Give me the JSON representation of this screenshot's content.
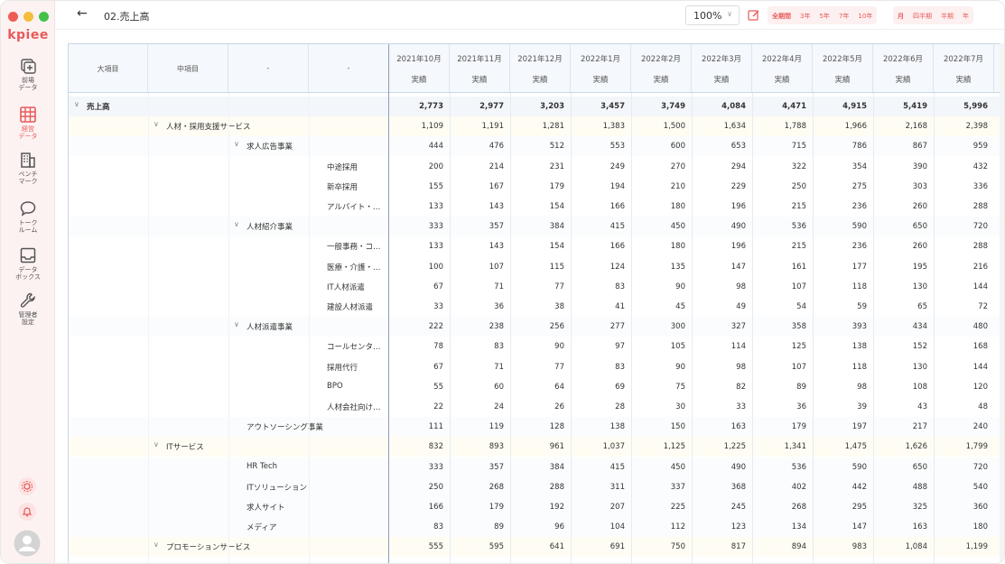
{
  "app": {
    "logo": "kpiee",
    "nav": [
      {
        "label": "前場\nデータ",
        "icon": "add-square-icon",
        "active": false
      },
      {
        "label": "経営\nデータ",
        "icon": "table-icon",
        "active": true
      },
      {
        "label": "ベンチ\nマーク",
        "icon": "building-icon",
        "active": false
      },
      {
        "label": "トーク\nルーム",
        "icon": "chat-icon",
        "active": false
      },
      {
        "label": "データ\nボックス",
        "icon": "inbox-icon",
        "active": false
      },
      {
        "label": "管理者\n設定",
        "icon": "wrench-icon",
        "active": false
      }
    ],
    "accent": "#e85a5a"
  },
  "topbar": {
    "title": "02.売上高",
    "zoom": "100%",
    "range_buttons": [
      "全期間",
      "3年",
      "5年",
      "7年",
      "10年"
    ],
    "range_selected": "全期間",
    "granularity_buttons": [
      "月",
      "四半期",
      "半期",
      "年"
    ],
    "granularity_selected": "月"
  },
  "table": {
    "dim_headers": [
      "大項目",
      "中項目",
      "-",
      "-"
    ],
    "months": [
      "2021年10月",
      "2021年11月",
      "2021年12月",
      "2022年1月",
      "2022年2月",
      "2022年3月",
      "2022年4月",
      "2022年5月",
      "2022年6月",
      "2022年7月"
    ],
    "sub_header": "実績",
    "rows": [
      {
        "level": 0,
        "label": "売上高",
        "expand": true,
        "values": [
          "2,773",
          "2,977",
          "3,203",
          "3,457",
          "3,749",
          "4,084",
          "4,471",
          "4,915",
          "5,419",
          "5,996"
        ]
      },
      {
        "level": 1,
        "label": "人材・採用支援サービス",
        "expand": true,
        "values": [
          "1,109",
          "1,191",
          "1,281",
          "1,383",
          "1,500",
          "1,634",
          "1,788",
          "1,966",
          "2,168",
          "2,398"
        ]
      },
      {
        "level": 2,
        "label": "求人広告事業",
        "expand": true,
        "values": [
          "444",
          "476",
          "512",
          "553",
          "600",
          "653",
          "715",
          "786",
          "867",
          "959"
        ]
      },
      {
        "level": 3,
        "label": "中途採用",
        "expand": false,
        "values": [
          "200",
          "214",
          "231",
          "249",
          "270",
          "294",
          "322",
          "354",
          "390",
          "432"
        ]
      },
      {
        "level": 3,
        "label": "新卒採用",
        "expand": false,
        "values": [
          "155",
          "167",
          "179",
          "194",
          "210",
          "229",
          "250",
          "275",
          "303",
          "336"
        ]
      },
      {
        "level": 3,
        "label": "アルバイト・…",
        "expand": false,
        "values": [
          "133",
          "143",
          "154",
          "166",
          "180",
          "196",
          "215",
          "236",
          "260",
          "288"
        ]
      },
      {
        "level": 2,
        "label": "人材紹介事業",
        "expand": true,
        "values": [
          "333",
          "357",
          "384",
          "415",
          "450",
          "490",
          "536",
          "590",
          "650",
          "720"
        ]
      },
      {
        "level": 3,
        "label": "一般事務・コ…",
        "expand": false,
        "values": [
          "133",
          "143",
          "154",
          "166",
          "180",
          "196",
          "215",
          "236",
          "260",
          "288"
        ]
      },
      {
        "level": 3,
        "label": "医療・介護・…",
        "expand": false,
        "values": [
          "100",
          "107",
          "115",
          "124",
          "135",
          "147",
          "161",
          "177",
          "195",
          "216"
        ]
      },
      {
        "level": 3,
        "label": "IT人材派遣",
        "expand": false,
        "values": [
          "67",
          "71",
          "77",
          "83",
          "90",
          "98",
          "107",
          "118",
          "130",
          "144"
        ]
      },
      {
        "level": 3,
        "label": "建設人材派遣",
        "expand": false,
        "values": [
          "33",
          "36",
          "38",
          "41",
          "45",
          "49",
          "54",
          "59",
          "65",
          "72"
        ]
      },
      {
        "level": 2,
        "label": "人材派遣事業",
        "expand": true,
        "values": [
          "222",
          "238",
          "256",
          "277",
          "300",
          "327",
          "358",
          "393",
          "434",
          "480"
        ]
      },
      {
        "level": 3,
        "label": "コールセンタ…",
        "expand": false,
        "values": [
          "78",
          "83",
          "90",
          "97",
          "105",
          "114",
          "125",
          "138",
          "152",
          "168"
        ]
      },
      {
        "level": 3,
        "label": "採用代行",
        "expand": false,
        "values": [
          "67",
          "71",
          "77",
          "83",
          "90",
          "98",
          "107",
          "118",
          "130",
          "144"
        ]
      },
      {
        "level": 3,
        "label": "BPO",
        "expand": false,
        "values": [
          "55",
          "60",
          "64",
          "69",
          "75",
          "82",
          "89",
          "98",
          "108",
          "120"
        ]
      },
      {
        "level": 3,
        "label": "人材会社向け…",
        "expand": false,
        "values": [
          "22",
          "24",
          "26",
          "28",
          "30",
          "33",
          "36",
          "39",
          "43",
          "48"
        ]
      },
      {
        "level": 2,
        "label": "アウトソーシング事業",
        "expand": false,
        "values": [
          "111",
          "119",
          "128",
          "138",
          "150",
          "163",
          "179",
          "197",
          "217",
          "240"
        ]
      },
      {
        "level": 1,
        "label": "ITサービス",
        "expand": true,
        "values": [
          "832",
          "893",
          "961",
          "1,037",
          "1,125",
          "1,225",
          "1,341",
          "1,475",
          "1,626",
          "1,799"
        ]
      },
      {
        "level": 2,
        "label": "HR Tech",
        "expand": false,
        "values": [
          "333",
          "357",
          "384",
          "415",
          "450",
          "490",
          "536",
          "590",
          "650",
          "720"
        ]
      },
      {
        "level": 2,
        "label": "ITソリューション",
        "expand": false,
        "values": [
          "250",
          "268",
          "288",
          "311",
          "337",
          "368",
          "402",
          "442",
          "488",
          "540"
        ]
      },
      {
        "level": 2,
        "label": "求人サイト",
        "expand": false,
        "values": [
          "166",
          "179",
          "192",
          "207",
          "225",
          "245",
          "268",
          "295",
          "325",
          "360"
        ]
      },
      {
        "level": 2,
        "label": "メディア",
        "expand": false,
        "values": [
          "83",
          "89",
          "96",
          "104",
          "112",
          "123",
          "134",
          "147",
          "163",
          "180"
        ]
      },
      {
        "level": 1,
        "label": "プロモーションサービス",
        "expand": true,
        "values": [
          "555",
          "595",
          "641",
          "691",
          "750",
          "817",
          "894",
          "983",
          "1,084",
          "1,199"
        ]
      }
    ]
  }
}
